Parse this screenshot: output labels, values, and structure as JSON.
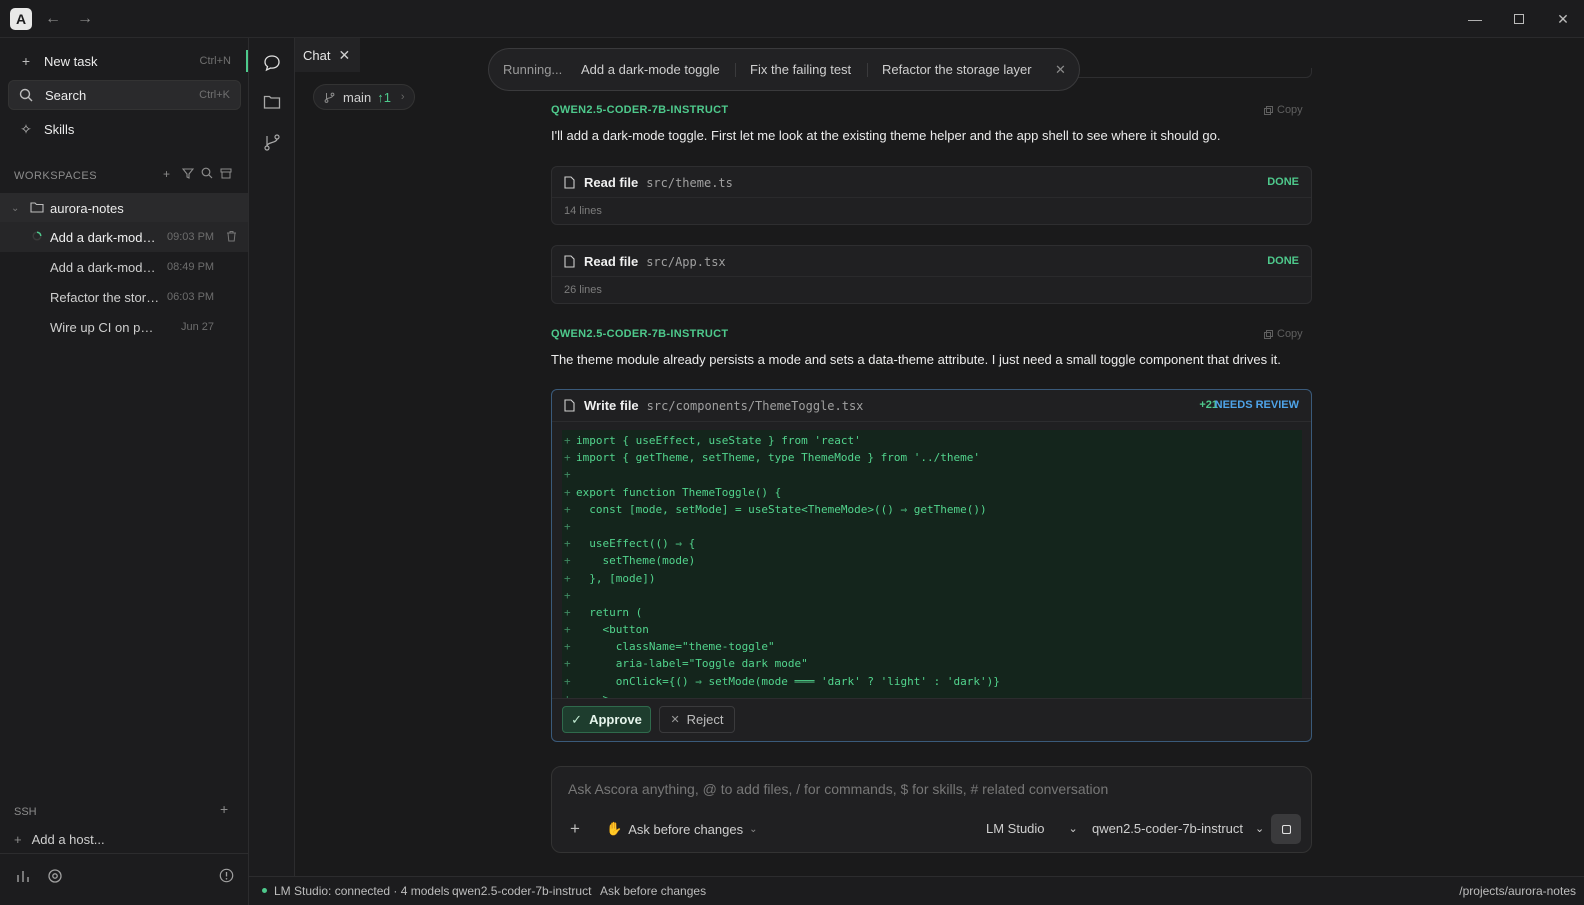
{
  "app": {
    "logo_letter": "A"
  },
  "sidebar": {
    "new_task": {
      "label": "New task",
      "shortcut": "Ctrl+N"
    },
    "search": {
      "label": "Search",
      "shortcut": "Ctrl+K"
    },
    "skills": {
      "label": "Skills"
    },
    "workspaces_header": "WORKSPACES",
    "workspace": {
      "name": "aurora-notes"
    },
    "tasks": [
      {
        "name": "Add a dark-mode toggle",
        "time": "09:03 PM",
        "active": true
      },
      {
        "name": "Add a dark-mode toggle",
        "time": "08:49 PM"
      },
      {
        "name": "Refactor the storage layer",
        "time": "06:03 PM"
      },
      {
        "name": "Wire up CI on push",
        "time": "Jun 27"
      }
    ],
    "ssh_header": "SSH",
    "add_host": "Add a host..."
  },
  "main": {
    "tab_label": "Chat",
    "branch": {
      "name": "main",
      "ahead": "↑1"
    },
    "running": {
      "status": "Running...",
      "queue": [
        "Add a dark-mode toggle",
        "Fix the failing test",
        "Refactor the storage layer"
      ]
    },
    "messages": [
      {
        "author": "QWEN2.5-CODER-7B-INSTRUCT",
        "copy_label": "Copy",
        "text": "I'll add a dark-mode toggle. First let me look at the existing theme helper and the app shell to see where it should go."
      },
      {
        "author": "QWEN2.5-CODER-7B-INSTRUCT",
        "copy_label": "Copy",
        "text": "The theme module already persists a mode and sets a data-theme attribute. I just need a small toggle component that drives it."
      }
    ],
    "tool_calls": [
      {
        "action": "Read file",
        "path": "src/theme.ts",
        "detail": "14 lines",
        "status": "DONE"
      },
      {
        "action": "Read file",
        "path": "src/App.tsx",
        "detail": "26 lines",
        "status": "DONE"
      }
    ],
    "write_card": {
      "action": "Write file",
      "path": "src/components/ThemeToggle.tsx",
      "added": "+21",
      "status": "NEEDS REVIEW",
      "approve_label": "Approve",
      "reject_label": "Reject",
      "diff_lines": [
        "import { useEffect, useState } from 'react'",
        "import { getTheme, setTheme, type ThemeMode } from '../theme'",
        "",
        "export function ThemeToggle() {",
        "  const [mode, setMode] = useState<ThemeMode>(() ⇒ getTheme())",
        "",
        "  useEffect(() ⇒ {",
        "    setTheme(mode)",
        "  }, [mode])",
        "",
        "  return (",
        "    <button",
        "      className=\"theme-toggle\"",
        "      aria-label=\"Toggle dark mode\"",
        "      onClick={() ⇒ setMode(mode ═══ 'dark' ? 'light' : 'dark')}",
        "    >"
      ]
    },
    "composer": {
      "placeholder": "Ask Ascora anything, @ to add files, / for commands, $ for skills, # related conversation",
      "permission_mode": "Ask before changes",
      "provider": "LM Studio",
      "model": "qwen2.5-coder-7b-instruct"
    }
  },
  "statusbar": {
    "connection": "LM Studio: connected · 4 models",
    "model": "qwen2.5-coder-7b-instruct",
    "mode": "Ask before changes",
    "path": "/projects/aurora-notes"
  },
  "colors": {
    "accent_green": "#4ec98c",
    "review_blue": "#4ea3e8",
    "diff_bg": "#14251c"
  }
}
